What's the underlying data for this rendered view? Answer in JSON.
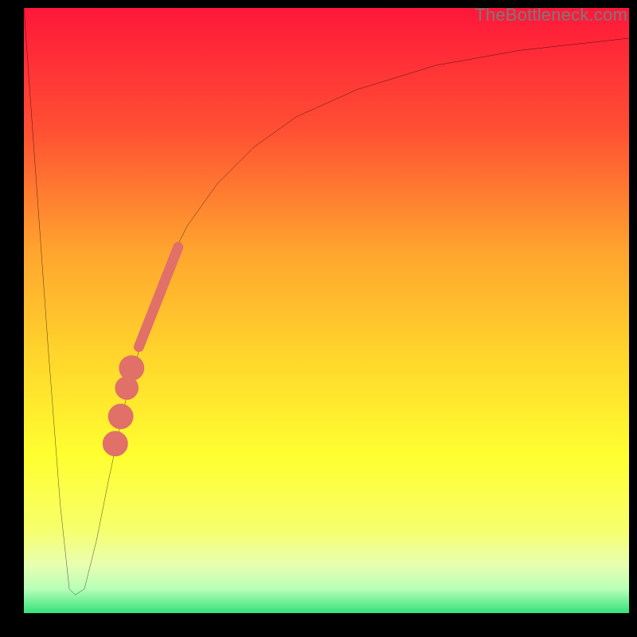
{
  "watermark": "TheBottleneck.com",
  "colors": {
    "frame": "#000000",
    "gradient_stops": [
      {
        "offset": 0.0,
        "color": "#ff173a"
      },
      {
        "offset": 0.2,
        "color": "#ff4f33"
      },
      {
        "offset": 0.4,
        "color": "#ffa42e"
      },
      {
        "offset": 0.58,
        "color": "#ffd72c"
      },
      {
        "offset": 0.74,
        "color": "#ffff30"
      },
      {
        "offset": 0.86,
        "color": "#f7ff6a"
      },
      {
        "offset": 0.92,
        "color": "#e8ffb0"
      },
      {
        "offset": 0.96,
        "color": "#b8ffb8"
      },
      {
        "offset": 1.0,
        "color": "#35e27a"
      }
    ],
    "curve": "#000000",
    "dot_fill": "#e07068",
    "dot_stroke": "#e07068"
  },
  "chart_data": {
    "type": "line",
    "title": "",
    "xlabel": "",
    "ylabel": "",
    "xlim": [
      0,
      100
    ],
    "ylim": [
      0,
      100
    ],
    "series": [
      {
        "name": "bottleneck-curve",
        "x": [
          0,
          2,
          4,
          6,
          7.5,
          8.5,
          10,
          12,
          14,
          17,
          20,
          23,
          27,
          32,
          38,
          45,
          55,
          68,
          82,
          100
        ],
        "y": [
          100,
          72,
          44,
          18,
          4,
          3,
          4,
          12,
          22,
          36,
          47,
          56,
          64,
          71,
          77,
          82,
          86.5,
          90.5,
          93,
          95
        ]
      }
    ],
    "markers": {
      "name": "highlight-segment",
      "stroke_points": {
        "start": {
          "x": 19,
          "y": 44
        },
        "end": {
          "x": 25.5,
          "y": 60.5
        }
      },
      "dots": [
        {
          "x": 17.8,
          "y": 40.5,
          "r": 1.6
        },
        {
          "x": 17.0,
          "y": 37.2,
          "r": 1.45
        },
        {
          "x": 16.0,
          "y": 32.5,
          "r": 1.6
        },
        {
          "x": 15.1,
          "y": 28.0,
          "r": 1.6
        }
      ]
    }
  }
}
